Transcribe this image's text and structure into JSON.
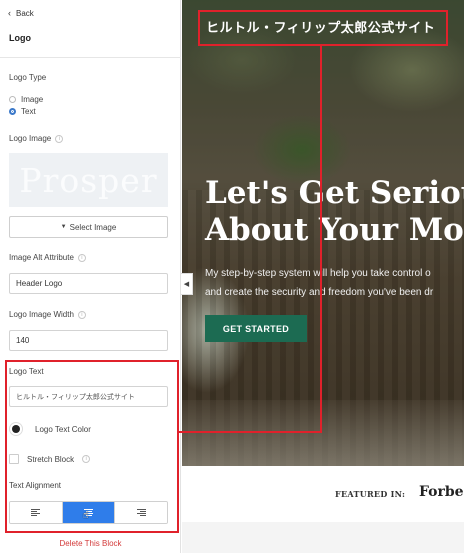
{
  "panel": {
    "back_label": "Back",
    "title": "Logo",
    "logo_type": {
      "label": "Logo Type",
      "options": [
        "Image",
        "Text"
      ],
      "selected": "Text"
    },
    "logo_image": {
      "label": "Logo Image",
      "preview_text": "Prosper",
      "select_button": "Select Image"
    },
    "alt_attribute": {
      "label": "Image Alt Attribute",
      "value": "Header Logo"
    },
    "image_width": {
      "label": "Logo Image Width",
      "value": "140"
    },
    "logo_text": {
      "label": "Logo Text",
      "value": "ヒルトル・フィリップ太郎公式サイト"
    },
    "text_color": {
      "label": "Logo Text Color",
      "swatch_color": "#222222"
    },
    "stretch_block": {
      "label": "Stretch Block",
      "checked": false
    },
    "text_alignment": {
      "label": "Text Alignment",
      "options": [
        "left",
        "center",
        "right"
      ],
      "selected": "center"
    },
    "delete_label": "Delete This Block"
  },
  "preview": {
    "site_logo_text": "ヒルトル・フィリップ太郎公式サイト",
    "hero_title_line1": "Let's Get Seriou",
    "hero_title_line2": "About Your Mo",
    "hero_sub_line1": "My step-by-step system will help you take control o",
    "hero_sub_line2": "and create the security and freedom you've been dr",
    "cta_label": "GET STARTED",
    "featured_label": "FEATURED IN:",
    "featured_logo": "Forbes"
  },
  "colors": {
    "accent": "#2f7dea",
    "cta": "#1c6b52",
    "annotation": "#e0212b",
    "delete": "#d33a3a"
  }
}
